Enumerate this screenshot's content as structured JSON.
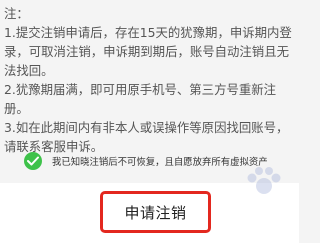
{
  "notes": {
    "heading": "注：",
    "line1": "1.提交注销申请后，存在15天的犹豫期，申诉期内登录，可取消注销，申诉期到期后，账号自动注销且无法找回。",
    "line2": "2.犹豫期届满，即可用原手机号、第三方号重新注册。",
    "line3": "3.如在此期间内有非本人或误操作等原因找回账号，请联系客服申诉。"
  },
  "agreement": {
    "checked": true,
    "text": "我已知晓注销后不可恢复，且自愿放弃所有虚拟资产",
    "check_color": "#3ec24a"
  },
  "actions": {
    "apply_label": "申请注销",
    "highlight_color": "#e3281f"
  }
}
